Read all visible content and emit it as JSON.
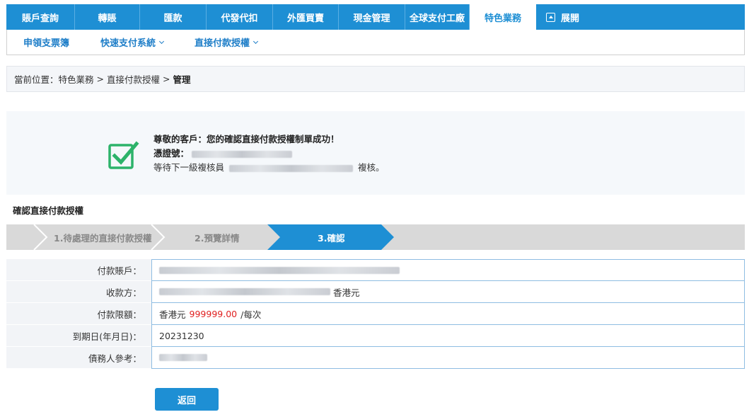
{
  "topnav": {
    "tabs": [
      {
        "label": "賬戶查詢",
        "width": 97
      },
      {
        "label": "轉賬",
        "width": 92
      },
      {
        "label": "匯款",
        "width": 94
      },
      {
        "label": "代發代扣",
        "width": 94
      },
      {
        "label": "外匯買賣",
        "width": 93
      },
      {
        "label": "現金管理",
        "width": 94
      },
      {
        "label": "全球支付工廠",
        "width": 91
      },
      {
        "label": "特色業務",
        "width": 94,
        "active": true
      }
    ],
    "expand_label": "展開"
  },
  "subnav": {
    "items": [
      {
        "label": "申領支票簿",
        "dropdown": false
      },
      {
        "label": "快速支付系統",
        "dropdown": true
      },
      {
        "label": "直接付款授權",
        "dropdown": true
      }
    ]
  },
  "breadcrumb": {
    "prefix": "當前位置：",
    "crumbs": [
      "特色業務",
      "直接付款授權"
    ],
    "current": "管理"
  },
  "success": {
    "title": "尊敬的客戶：您的確認直接付款授權制單成功！",
    "voucher_label": "憑證號：",
    "wait_prefix": "等待下一級複核員",
    "wait_suffix": "複核。"
  },
  "section_title": "確認直接付款授權",
  "steps": [
    {
      "label": "1.待處理的直接付款授權",
      "state": "done"
    },
    {
      "label": "2.預覽詳情",
      "state": "done"
    },
    {
      "label": "3.確認",
      "state": "active"
    }
  ],
  "form": {
    "payer_account_label": "付款賬戶：",
    "payee_label": "收款方：",
    "payee_currency": "香港元",
    "limit_label": "付款限額：",
    "limit_currency": "香港元",
    "limit_amount": "999999.00",
    "limit_unit": "/每次",
    "expiry_label": "到期日(年月日)：",
    "expiry_value": "20231230",
    "debtor_ref_label": "債務人參考："
  },
  "buttons": {
    "back": "返回"
  },
  "colors": {
    "primary": "#1e8fd4",
    "success_green": "#2db36a",
    "amount_red": "#e02020"
  }
}
